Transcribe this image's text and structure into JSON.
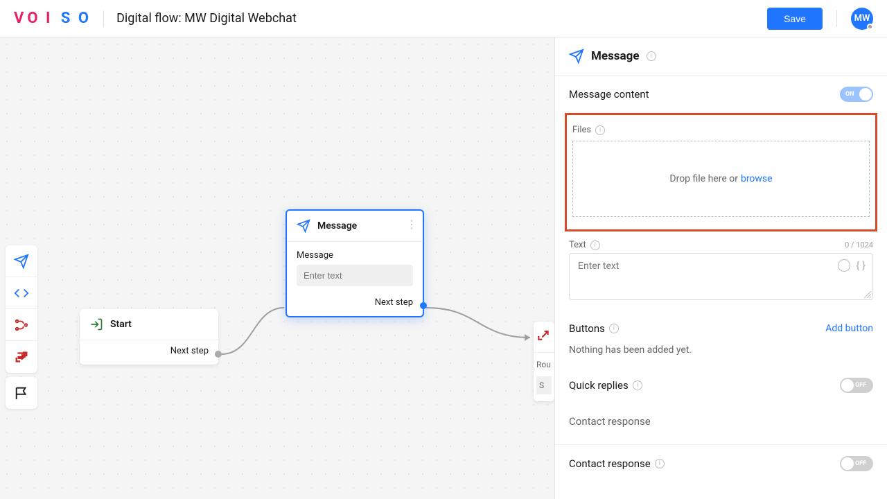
{
  "header": {
    "logo_text": "VOISO",
    "title": "Digital flow: MW Digital Webchat",
    "save": "Save",
    "avatar": "MW"
  },
  "tools": {
    "send": "send-icon",
    "api": "api-icon",
    "flow": "flow-icon",
    "route": "route-icon",
    "flag": "flag-icon"
  },
  "nodes": {
    "start": {
      "title": "Start",
      "next": "Next step"
    },
    "message": {
      "title": "Message",
      "field_label": "Message",
      "placeholder": "Enter text",
      "next": "Next step"
    },
    "partial": {
      "route_label": "Rou",
      "s_label": "S"
    }
  },
  "panel": {
    "title": "Message",
    "message_content": "Message content",
    "toggle_on": "ON",
    "toggle_off": "OFF",
    "files_label": "Files",
    "drop_text": "Drop file here or ",
    "browse": "browse",
    "text_label": "Text",
    "char_count": "0 / 1024",
    "text_placeholder": "Enter text",
    "buttons_label": "Buttons",
    "add_button": "Add button",
    "nothing_added": "Nothing has been added yet.",
    "quick_replies": "Quick replies",
    "contact_response_muted": "Contact response",
    "contact_response": "Contact response"
  }
}
